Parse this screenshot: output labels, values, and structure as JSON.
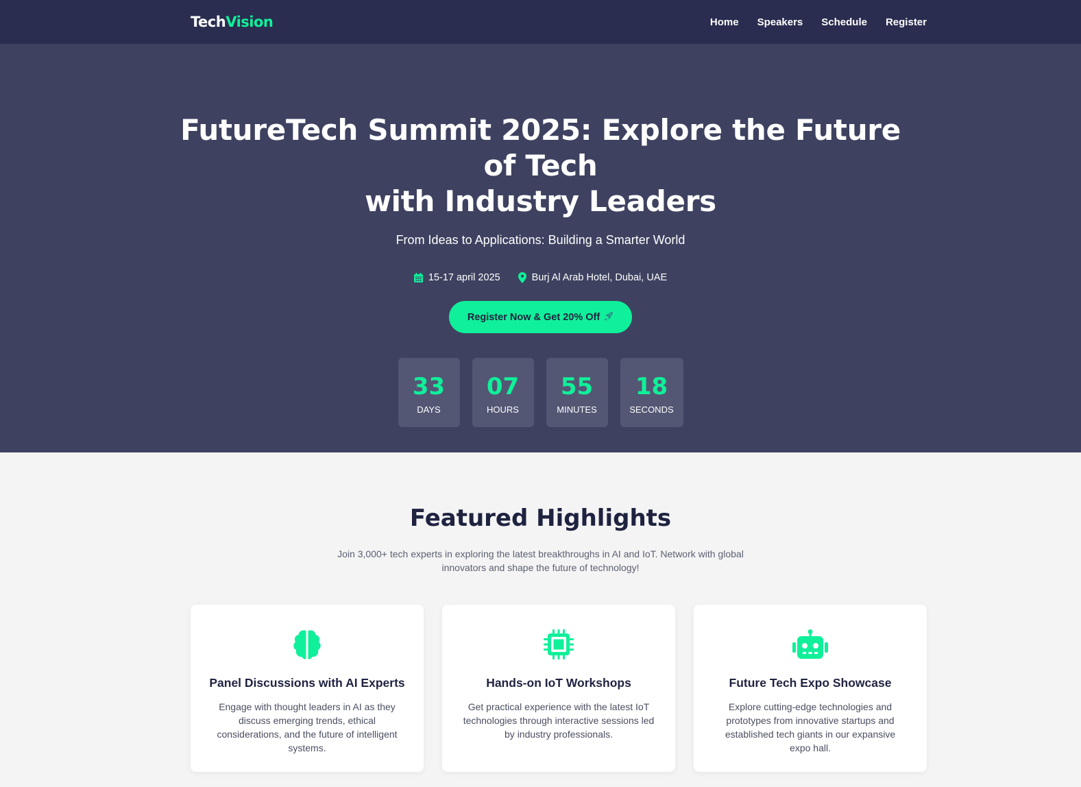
{
  "nav": {
    "logo_part1": "Tech",
    "logo_part2": "Vision",
    "links": [
      "Home",
      "Speakers",
      "Schedule",
      "Register"
    ]
  },
  "hero": {
    "title_line1": "FutureTech Summit 2025: Explore the Future of Tech",
    "title_line2": "with Industry Leaders",
    "subtitle": "From Ideas to Applications: Building a Smarter World",
    "date": "15-17 april 2025",
    "location": "Burj Al Arab Hotel, Dubai, UAE",
    "cta_label": "Register Now & Get 20% Off"
  },
  "countdown": [
    {
      "value": "33",
      "label": "DAYS"
    },
    {
      "value": "07",
      "label": "HOURS"
    },
    {
      "value": "55",
      "label": "MINUTES"
    },
    {
      "value": "18",
      "label": "SECONDS"
    }
  ],
  "features": {
    "title": "Featured Highlights",
    "lead_line1": "Join 3,000+ tech experts in exploring the latest breakthroughs in AI and IoT. Network with global",
    "lead_line2": "innovators and shape the future of technology!",
    "cards": [
      {
        "icon": "brain-icon",
        "title": "Panel Discussions with AI Experts",
        "text": "Engage with thought leaders in AI as they discuss emerging trends, ethical considerations, and the future of intelligent systems."
      },
      {
        "icon": "chip-icon",
        "title": "Hands-on IoT Workshops",
        "text": "Get practical experience with the latest IoT technologies through interactive sessions led by industry professionals."
      },
      {
        "icon": "robot-icon",
        "title": "Future Tech Expo Showcase",
        "text": "Explore cutting-edge technologies and prototypes from innovative startups and established tech giants in our expansive expo hall."
      }
    ]
  },
  "colors": {
    "accent": "#10f09a",
    "navbar": "#2a2d4f",
    "hero_bg": "#3e4260",
    "countdown_box": "#535774",
    "page_bg": "#f4f4f5"
  }
}
